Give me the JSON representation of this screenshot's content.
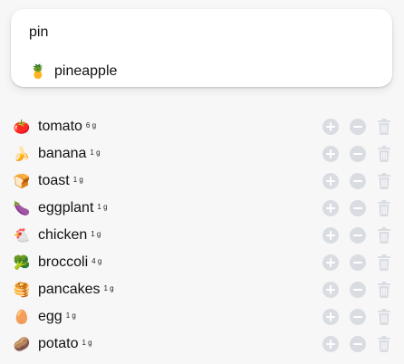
{
  "search": {
    "value": "pin",
    "placeholder": ""
  },
  "suggestion": {
    "icon": "pineapple-icon",
    "emoji": "🍍",
    "label": "pineapple"
  },
  "items": [
    {
      "emoji": "🍅",
      "icon": "tomato-icon",
      "name": "tomato",
      "qty": "6 g"
    },
    {
      "emoji": "🍌",
      "icon": "banana-icon",
      "name": "banana",
      "qty": "1 g"
    },
    {
      "emoji": "🍞",
      "icon": "toast-icon",
      "name": "toast",
      "qty": "1 g"
    },
    {
      "emoji": "🍆",
      "icon": "eggplant-icon",
      "name": "eggplant",
      "qty": "1 g"
    },
    {
      "emoji": "🐔",
      "icon": "chicken-icon",
      "name": "chicken",
      "qty": "1 g"
    },
    {
      "emoji": "🥦",
      "icon": "broccoli-icon",
      "name": "broccoli",
      "qty": "4 g"
    },
    {
      "emoji": "🥞",
      "icon": "pancakes-icon",
      "name": "pancakes",
      "qty": "1 g"
    },
    {
      "emoji": "🥚",
      "icon": "egg-icon",
      "name": "egg",
      "qty": "1 g"
    },
    {
      "emoji": "🥔",
      "icon": "potato-icon",
      "name": "potato",
      "qty": "1 g"
    }
  ],
  "colors": {
    "action_icon": "#d9dde2",
    "card_bg": "#ffffff",
    "page_bg": "#f7f7f7"
  }
}
